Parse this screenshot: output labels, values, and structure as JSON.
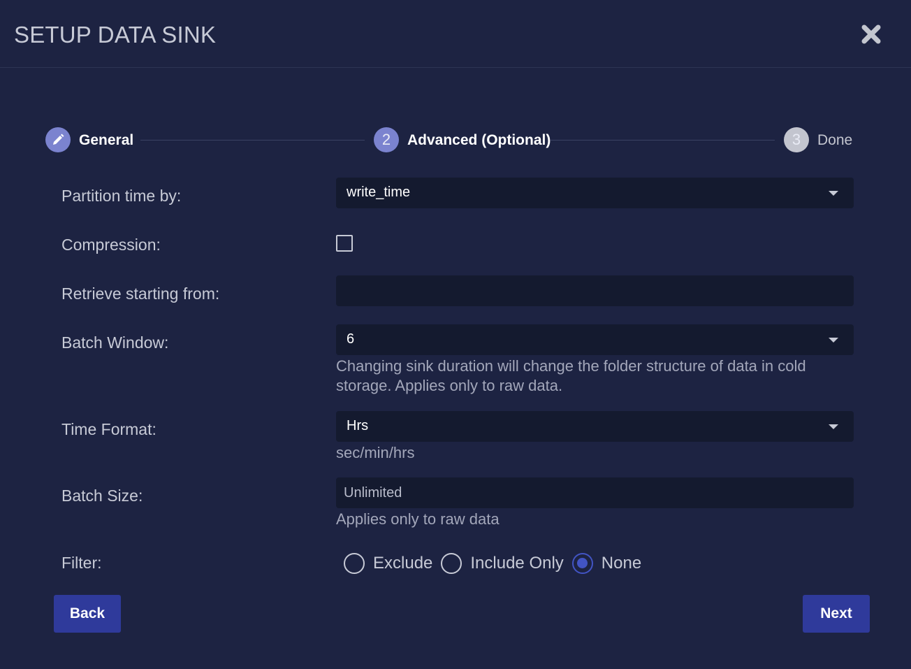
{
  "dialog": {
    "title": "SETUP DATA SINK"
  },
  "stepper": {
    "steps": [
      {
        "number": "1",
        "label": "General",
        "state": "completed",
        "icon": "pencil-icon"
      },
      {
        "number": "2",
        "label": "Advanced (Optional)",
        "state": "active"
      },
      {
        "number": "3",
        "label": "Done",
        "state": "inactive"
      }
    ]
  },
  "form": {
    "partition": {
      "label": "Partition time by:",
      "value": "write_time"
    },
    "compression": {
      "label": "Compression:",
      "checked": false
    },
    "retrieve": {
      "label": "Retrieve starting from:",
      "value": ""
    },
    "batch_window": {
      "label": "Batch Window:",
      "value": "6",
      "helper": "Changing sink duration will change the folder structure of data in cold storage. Applies only to raw data."
    },
    "time_format": {
      "label": "Time Format:",
      "value": "Hrs",
      "helper": "sec/min/hrs"
    },
    "batch_size": {
      "label": "Batch Size:",
      "placeholder": "Unlimited",
      "helper": "Applies only to raw data"
    },
    "filter": {
      "label": "Filter:",
      "options": [
        "Exclude",
        "Include Only",
        "None"
      ],
      "selected": "None"
    }
  },
  "buttons": {
    "back": "Back",
    "next": "Next"
  },
  "colors": {
    "background": "#1d2342",
    "field_background": "#141a2f",
    "accent": "#2f3a9b",
    "step_active": "#7b83cf",
    "step_inactive": "#c3c5cf",
    "radio_selected": "#4254c4"
  }
}
